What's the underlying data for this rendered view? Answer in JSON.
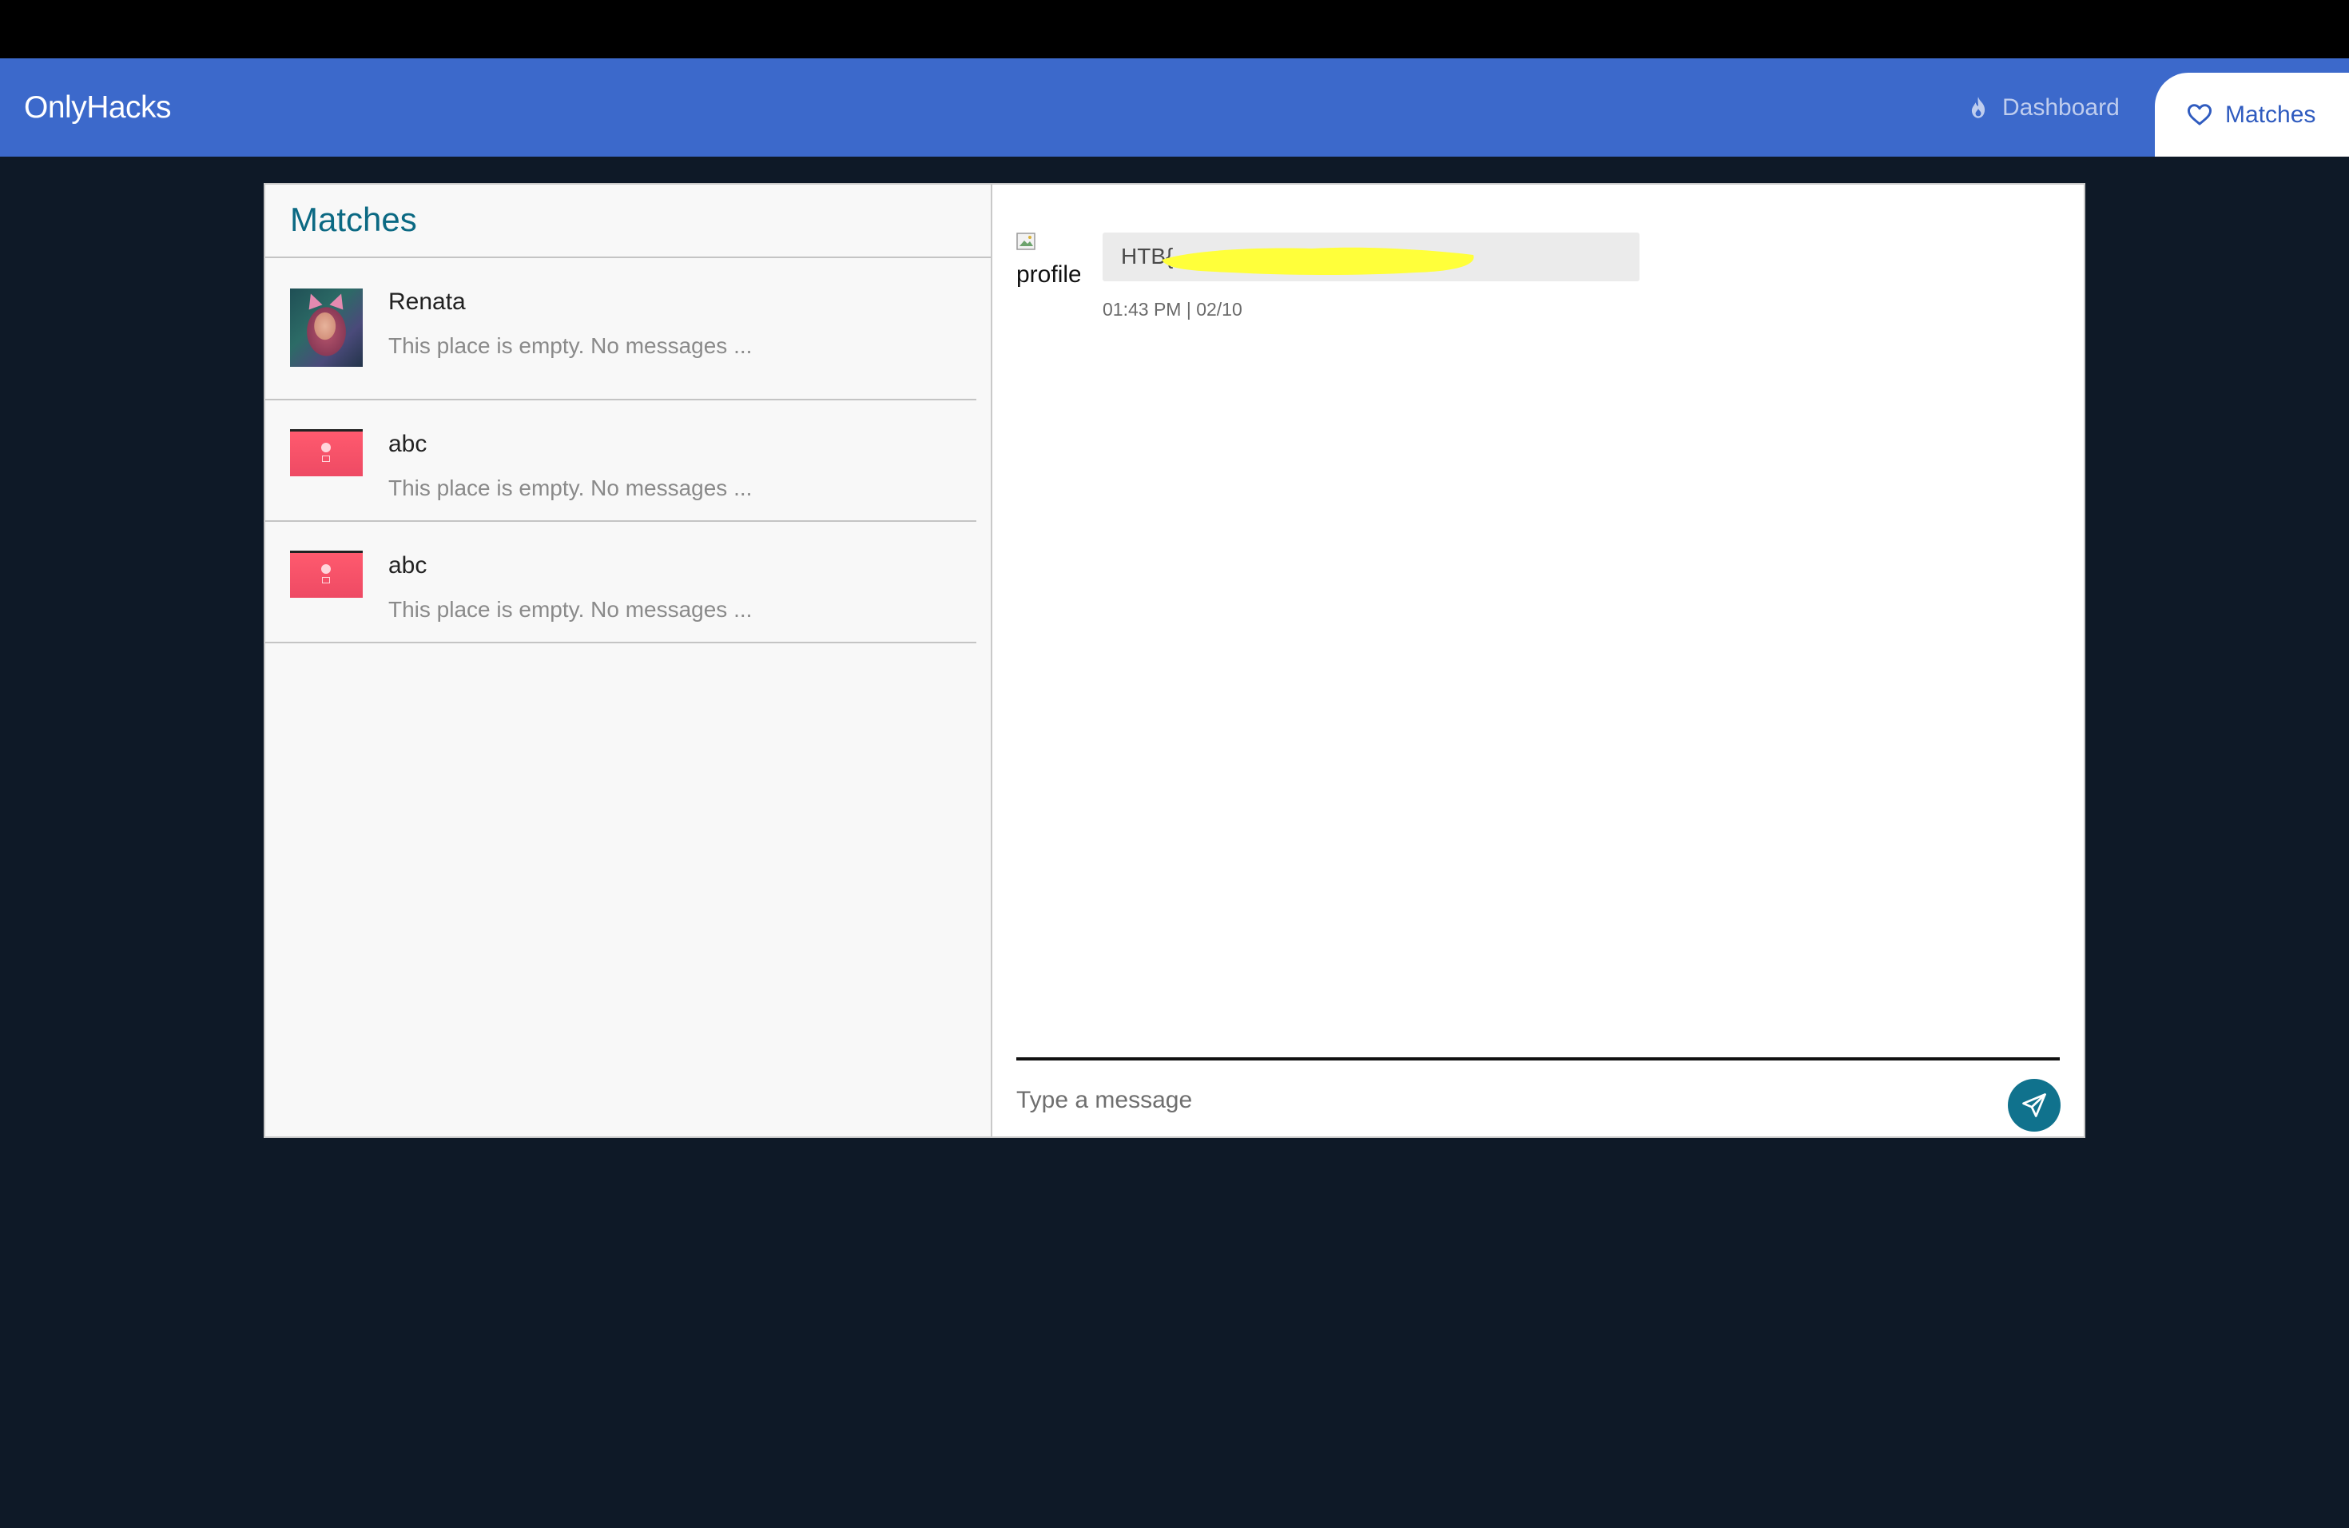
{
  "app": {
    "brand": "OnlyHacks",
    "accent_color": "#3c69cb",
    "background_color": "#0e1927"
  },
  "nav": {
    "items": [
      {
        "label": "Dashboard",
        "icon": "fire-icon",
        "active": false
      },
      {
        "label": "Matches",
        "icon": "heart-icon",
        "active": true
      }
    ]
  },
  "matches": {
    "title": "Matches",
    "items": [
      {
        "name": "Renata",
        "preview": "This place is empty. No messages ...",
        "avatar": "photo-avatar"
      },
      {
        "name": "abc",
        "preview": "This place is empty. No messages ...",
        "avatar": "placeholder-avatar"
      },
      {
        "name": "abc",
        "preview": "This place is empty. No messages ...",
        "avatar": "placeholder-avatar"
      }
    ]
  },
  "chat": {
    "messages": [
      {
        "sender_image_alt": "profile",
        "text": "HTB{",
        "text_redacted": true,
        "timestamp": "01:43 PM | 02/10"
      }
    ],
    "compose": {
      "placeholder": "Type a message",
      "value": "",
      "send_icon": "send-icon",
      "send_color": "#10728d"
    }
  }
}
